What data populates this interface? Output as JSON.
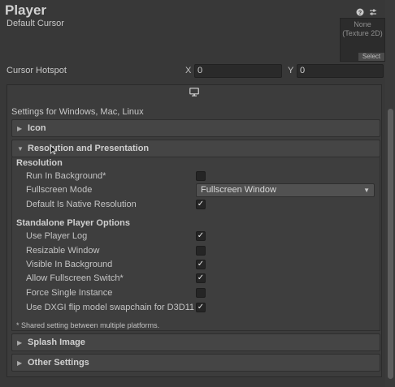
{
  "header": {
    "title": "Player",
    "icons": [
      "help-icon",
      "preset-icon",
      "more-icon"
    ]
  },
  "cursor": {
    "default_cursor_label": "Default Cursor",
    "texture_value": "None",
    "texture_type": "(Texture 2D)",
    "select_label": "Select",
    "hotspot_label": "Cursor Hotspot",
    "x_label": "X",
    "x_value": "0",
    "y_label": "Y",
    "y_value": "0"
  },
  "platform": {
    "icon": "monitor-icon",
    "settings_for": "Settings for Windows, Mac, Linux"
  },
  "sections": {
    "icon": "Icon",
    "resolution_presentation": "Resolution and Presentation",
    "splash_image": "Splash Image",
    "other_settings": "Other Settings"
  },
  "resolution": {
    "heading": "Resolution",
    "run_in_background": "Run In Background*",
    "run_in_background_checked": false,
    "fullscreen_mode": "Fullscreen Mode",
    "fullscreen_mode_value": "Fullscreen Window",
    "default_native": "Default Is Native Resolution",
    "default_native_checked": true
  },
  "standalone": {
    "heading": "Standalone Player Options",
    "items": [
      {
        "label": "Use Player Log",
        "checked": true
      },
      {
        "label": "Resizable Window",
        "checked": false
      },
      {
        "label": "Visible In Background",
        "checked": true
      },
      {
        "label": "Allow Fullscreen Switch*",
        "checked": true
      },
      {
        "label": "Force Single Instance",
        "checked": false
      },
      {
        "label": "Use DXGI flip model swapchain for D3D11",
        "checked": true
      }
    ]
  },
  "note": "* Shared setting between multiple platforms.",
  "colors": {
    "background": "#383838",
    "panel": "#3c3c3c",
    "foldout": "#454545",
    "checkbox": "#252525"
  }
}
